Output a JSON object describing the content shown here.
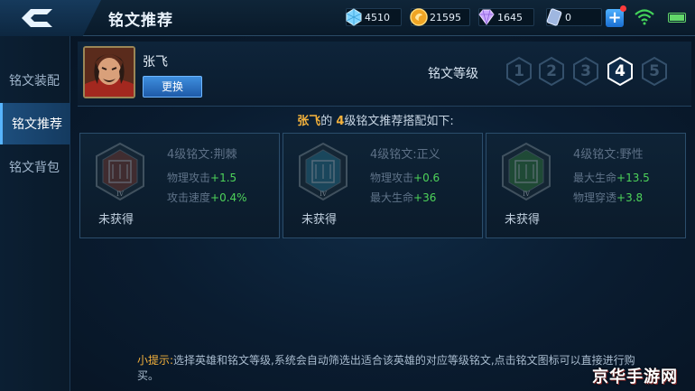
{
  "header": {
    "title": "铭文推荐",
    "resources": [
      {
        "icon": "diamond-icon",
        "value": "4510"
      },
      {
        "icon": "gold-coin-icon",
        "value": "21595"
      },
      {
        "icon": "gem-icon",
        "value": "1645"
      },
      {
        "icon": "ticket-icon",
        "value": "0"
      }
    ]
  },
  "sidebar": {
    "items": [
      {
        "label": "铭文装配"
      },
      {
        "label": "铭文推荐"
      },
      {
        "label": "铭文背包"
      }
    ],
    "active_index": 1
  },
  "hero": {
    "name": "张飞",
    "switch_label": "更换"
  },
  "level": {
    "label": "铭文等级",
    "options": [
      "1",
      "2",
      "3",
      "4",
      "5"
    ],
    "selected": "4"
  },
  "headline": {
    "hero": "张飞",
    "mid": "的 ",
    "level": "4",
    "suffix": "级铭文推荐搭配如下:"
  },
  "cards": [
    {
      "name": "4级铭文:荆棘",
      "status": "未获得",
      "color": "#a2402c",
      "stats": [
        {
          "label": "物理攻击",
          "value": "+1.5"
        },
        {
          "label": "攻击速度",
          "value": "+0.4%"
        }
      ]
    },
    {
      "name": "4级铭文:正义",
      "status": "未获得",
      "color": "#2f8fb0",
      "stats": [
        {
          "label": "物理攻击",
          "value": "+0.6"
        },
        {
          "label": "最大生命",
          "value": "+36"
        }
      ]
    },
    {
      "name": "4级铭文:野性",
      "status": "未获得",
      "color": "#3d9a3e",
      "stats": [
        {
          "label": "最大生命",
          "value": "+13.5"
        },
        {
          "label": "物理穿透",
          "value": "+3.8"
        }
      ]
    }
  ],
  "tip": {
    "prefix": "小提示:",
    "text": "选择英雄和铭文等级,系统会自动筛选出适合该英雄的对应等级铭文,点击铭文图标可以直接进行购买。"
  },
  "watermark": "京华手游网",
  "colors": {
    "accent": "#57b4ff",
    "highlight": "#f5b23c",
    "stat_green": "#4ed35a"
  }
}
